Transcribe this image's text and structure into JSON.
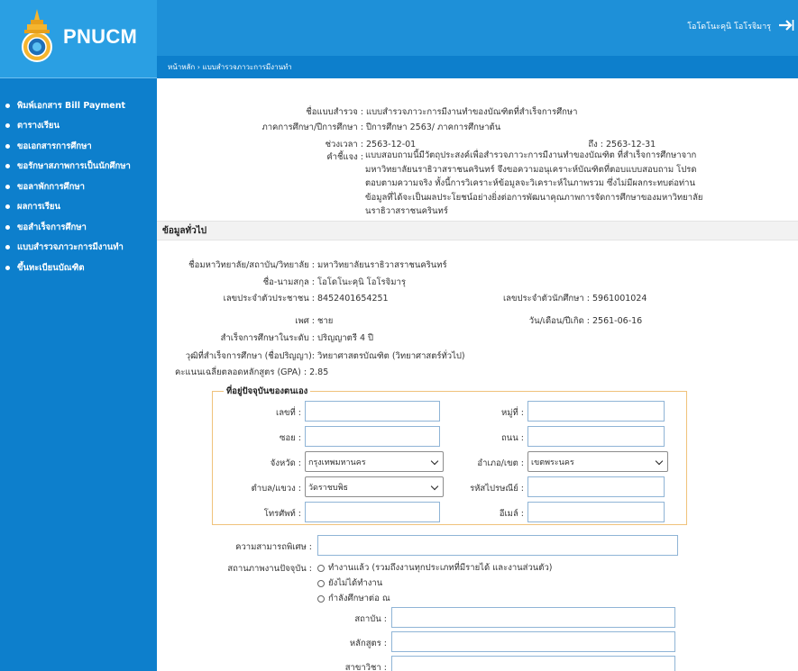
{
  "app": {
    "logo_text": "PNUCM",
    "user_name": "โอโดโนะคุนิ โอโรจิมารุ"
  },
  "breadcrumb": "หน้าหลัก › แบบสำรวจภาวะการมีงานทำ",
  "sidebar": {
    "items": [
      {
        "label": "พิมพ์เอกสาร Bill Payment"
      },
      {
        "label": "ตารางเรียน"
      },
      {
        "label": "ขอเอกสารการศึกษา"
      },
      {
        "label": "ขอรักษาสภาพการเป็นนักศึกษา"
      },
      {
        "label": "ขอลาพักการศึกษา"
      },
      {
        "label": "ผลการเรียน"
      },
      {
        "label": "ขอสำเร็จการศึกษา"
      },
      {
        "label": "แบบสำรวจภาวะการมีงานทำ"
      },
      {
        "label": "ขึ้นทะเบียนบัณฑิต"
      }
    ]
  },
  "survey": {
    "name_label": "ชื่อแบบสำรวจ :",
    "name_value": "แบบสำรวจภาวะการมีงานทำของบัณฑิตที่สำเร็จการศึกษา",
    "term_label": "ภาคการศึกษา/ปีการศึกษา :",
    "term_value": "ปีการศึกษา 2563/ ภาคการศึกษาต้น",
    "period_label": "ช่วงเวลา :",
    "period_value": "2563-12-01",
    "to_label": "ถึง :",
    "to_value": "2563-12-31",
    "desc_label": "คำชี้แจง :",
    "desc_value": "แบบสอบถามนี้มีวัตถุประสงค์เพื่อสำรวจภาวะการมีงานทำของบัณฑิต ที่สำเร็จการศึกษาจากมหาวิทยาลัยนราธิวาสราชนครินทร์ จึงขอความอนุเคราะห์บัณฑิตที่ตอบแบบสอบถาม โปรดตอบตามความจริง ทั้งนี้การวิเคราะห์ข้อมูลจะวิเคราะห์ในภาพรวม ซึ่งไม่มีผลกระทบต่อท่าน ข้อมูลที่ได้จะเป็นผลประโยชน์อย่างยิ่งต่อการพัฒนาคุณภาพการจัดการศึกษาของมหาวิทยาลัยนราธิวาสราชนครินทร์"
  },
  "general": {
    "section_title": "ข้อมูลทั่วไป",
    "university_label": "ชื่อมหาวิทยาลัย/สถาบัน/วิทยาลัย :",
    "university_value": "มหาวิทยาลัยนราธิวาสราชนครินทร์",
    "fullname_label": "ชื่อ-นามสกุล :",
    "fullname_value": "โอโดโนะคุนิ โอโรจิมารุ",
    "citizen_id_label": "เลขประจำตัวประชาชน :",
    "citizen_id_value": "8452401654251",
    "student_id_label": "เลขประจำตัวนักศึกษา :",
    "student_id_value": "5961001024",
    "gender_label": "เพศ :",
    "gender_value": "ชาย",
    "birthdate_label": "วัน/เดือน/ปีเกิด :",
    "birthdate_value": "2561-06-16",
    "level_label": "สำเร็จการศึกษาในระดับ :",
    "level_value": "ปริญญาตรี 4 ปี",
    "degree_label": "วุฒิที่สำเร็จการศึกษา (ชื่อปริญญา):",
    "degree_value": "วิทยาศาสตรบัณฑิต (วิทยาศาสตร์ทั่วไป)",
    "gpa_label": "คะแนนเฉลี่ยตลอดหลักสูตร (GPA) :",
    "gpa_value": "2.85"
  },
  "address": {
    "legend": "ที่อยู่ปัจจุบันของตนเอง",
    "house_no_label": "เลขที่ :",
    "moo_label": "หมู่ที่ :",
    "soi_label": "ซอย :",
    "road_label": "ถนน :",
    "province_label": "จังหวัด :",
    "province_value": "กรุงเทพมหานคร",
    "district_label": "อำเภอ/เขต :",
    "district_value": "เขตพระนคร",
    "subdistrict_label": "ตำบล/แขวง :",
    "subdistrict_value": "วัดราชบพิธ",
    "postcode_label": "รหัสไปรษณีย์ :",
    "phone_label": "โทรศัพท์ :",
    "email_label": "อีเมล์ :"
  },
  "employment": {
    "skill_label": "ความสามารถพิเศษ :",
    "status_label": "สถานภาพงานปัจจุบัน :",
    "options": [
      {
        "label": "ทำงานแล้ว (รวมถึงงานทุกประเภทที่มีรายได้ และงานส่วนตัว)"
      },
      {
        "label": "ยังไม่ได้ทำงาน"
      },
      {
        "label": "กำลังศึกษาต่อ ณ"
      }
    ],
    "institution_label": "สถาบัน :",
    "program_label": "หลักสูตร :",
    "major_label": "สาขาวิชา :"
  },
  "colors": {
    "sidebar_bg": "#0d7fcc",
    "header_bg": "#1e90d8",
    "logo_bg": "#2a9fe3",
    "fieldset_border": "#f0c27b",
    "input_border": "#8fb4d6"
  }
}
